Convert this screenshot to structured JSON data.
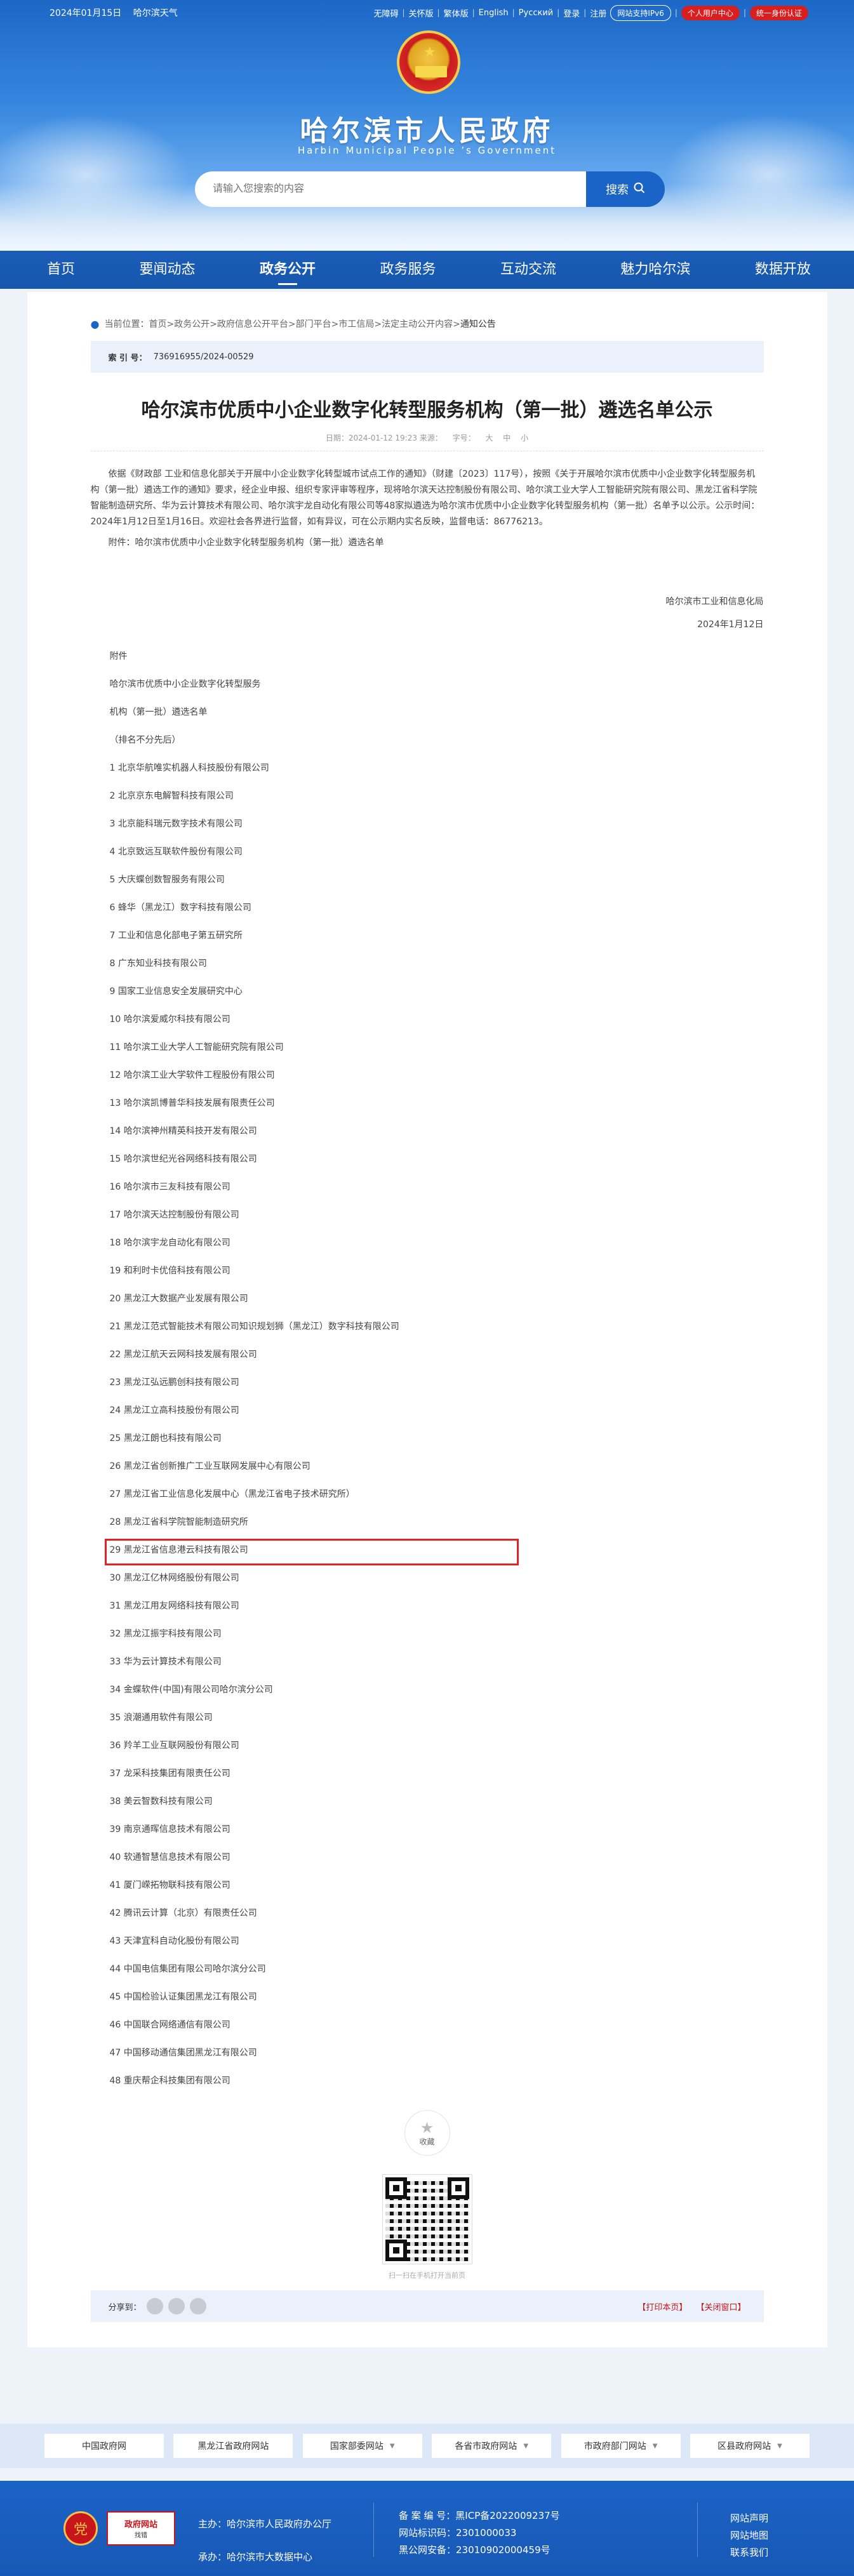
{
  "topbar": {
    "date": "2024年01月15日",
    "weather": "哈尔滨天气",
    "links": [
      "无障碍",
      "关怀版",
      "繁体版",
      "English",
      "Русский",
      "登录",
      "注册"
    ],
    "ipv6": "网站支持IPv6",
    "user_center": "个人用户中心",
    "unified_auth": "统一身份认证"
  },
  "header": {
    "title": "哈尔滨市人民政府",
    "subtitle": "Harbin Municipal People ’s Government"
  },
  "search": {
    "placeholder": "请输入您搜索的内容",
    "button": "搜索"
  },
  "nav": [
    "首页",
    "要闻动态",
    "政务公开",
    "政务服务",
    "互动交流",
    "魅力哈尔滨",
    "数据开放"
  ],
  "breadcrumb": {
    "prefix": "当前位置：",
    "path": "首页>政务公开>政府信息公开平台>部门平台>市工信局>法定主动公开内容>",
    "current": "通知公告"
  },
  "index": {
    "label": "索 引 号：",
    "value": "736916955/2024-00529"
  },
  "article": {
    "title": "哈尔滨市优质中小企业数字化转型服务机构（第一批）遴选名单公示",
    "date": "日期：2024-01-12 19:23 来源：",
    "font_label": "字号：",
    "font_large": "大",
    "font_mid": "中",
    "font_small": "小",
    "paragraph": "依据《财政部 工业和信息化部关于开展中小企业数字化转型城市试点工作的通知》（财建〔2023〕117号），按照《关于开展哈尔滨市优质中小企业数字化转型服务机构（第一批）遴选工作的通知》要求，经企业申报、组织专家评审等程序，现将哈尔滨天达控制股份有限公司、哈尔滨工业大学人工智能研究院有限公司、黑龙江省科学院智能制造研究所、华为云计算技术有限公司、哈尔滨宇龙自动化有限公司等48家拟遴选为哈尔滨市优质中小企业数字化转型服务机构（第一批）名单予以公示。公示时间：2024年1月12日至1月16日。欢迎社会各界进行监督，如有异议，可在公示期内实名反映，监督电话：86776213。",
    "attachment": "附件：哈尔滨市优质中小企业数字化转型服务机构（第一批）遴选名单",
    "signer": "哈尔滨市工业和信息化局",
    "sign_date": "2024年1月12日",
    "list_intro": [
      "附件",
      "哈尔滨市优质中小企业数字化转型服务",
      "机构（第一批）遴选名单",
      "（排名不分先后）"
    ]
  },
  "companies": [
    "1 北京华航唯实机器人科技股份有限公司",
    "2 北京京东电解智科技有限公司",
    "3 北京能科瑞元数字技术有限公司",
    "4 北京致远互联软件股份有限公司",
    "5 大庆蝶创数智服务有限公司",
    "6 蜂华（黑龙江）数字科技有限公司",
    "7 工业和信息化部电子第五研究所",
    "8 广东知业科技有限公司",
    "9 国家工业信息安全发展研究中心",
    "10 哈尔滨爱威尔科技有限公司",
    "11 哈尔滨工业大学人工智能研究院有限公司",
    "12 哈尔滨工业大学软件工程股份有限公司",
    "13 哈尔滨凯博普华科技发展有限责任公司",
    "14 哈尔滨神州精英科技开发有限公司",
    "15 哈尔滨世纪光谷网络科技有限公司",
    "16 哈尔滨市三友科技有限公司",
    "17 哈尔滨天达控制股份有限公司",
    "18 哈尔滨宇龙自动化有限公司",
    "19 和利时卡优倍科技有限公司",
    "20 黑龙江大数据产业发展有限公司",
    "21 黑龙江范式智能技术有限公司知识规划狮（黑龙江）数字科技有限公司",
    "22 黑龙江航天云网科技发展有限公司",
    "23 黑龙江弘远鹏创科技有限公司",
    "24 黑龙江立高科技股份有限公司",
    "25 黑龙江朗也科技有限公司",
    "26 黑龙江省创新推广工业互联网发展中心有限公司",
    "27 黑龙江省工业信息化发展中心（黑龙江省电子技术研究所）",
    "28 黑龙江省科学院智能制造研究所",
    "29 黑龙江省信息港云科技有限公司",
    "30 黑龙江亿林网络股份有限公司",
    "31 黑龙江用友网络科技有限公司",
    "32 黑龙江振宇科技有限公司",
    "33 华为云计算技术有限公司",
    "34 金蝶软件(中国)有限公司哈尔滨分公司",
    "35 浪潮通用软件有限公司",
    "36 羚羊工业互联网股份有限公司",
    "37 龙采科技集团有限责任公司",
    "38 美云智数科技有限公司",
    "39 南京通晖信息技术有限公司",
    "40 软通智慧信息技术有限公司",
    "41 厦门嵘拓物联科技有限公司",
    "42 腾讯云计算（北京）有限责任公司",
    "43 天津宜科自动化股份有限公司",
    "44 中国电信集团有限公司哈尔滨分公司",
    "45 中国检验认证集团黑龙江有限公司",
    "46 中国联合网络通信有限公司",
    "47 中国移动通信集团黑龙江有限公司",
    "48 重庆帮企科技集团有限公司"
  ],
  "highlight_index": 28,
  "favorite": "收藏",
  "qr_caption": "扫一扫在手机打开当前页",
  "share": {
    "label": "分享到：",
    "print": "【打印本页】",
    "close": "【关闭窗口】"
  },
  "footer_links": [
    "中国政府网",
    "黑龙江省政府网站",
    "国家部委网站",
    "各省市政府网站",
    "市政府部门网站",
    "区县政府网站"
  ],
  "footer": {
    "logo_text": "政府网站",
    "logo_sub": "找错",
    "sponsor": "主办：哈尔滨市人民政府办公厅",
    "organizer": "承办：哈尔滨市大数据中心",
    "icp": "备 案 编 号：黑ICP备2022009237号",
    "site_id": "网站标识码：2301000033",
    "police": "黑公网安备：23010902000459号",
    "menu": [
      "网站声明",
      "网站地图",
      "联系我们"
    ]
  },
  "colors": {
    "primary": "#1a64c8",
    "highlight_box": "#e02424",
    "footer_bg": "#1b63c6"
  }
}
